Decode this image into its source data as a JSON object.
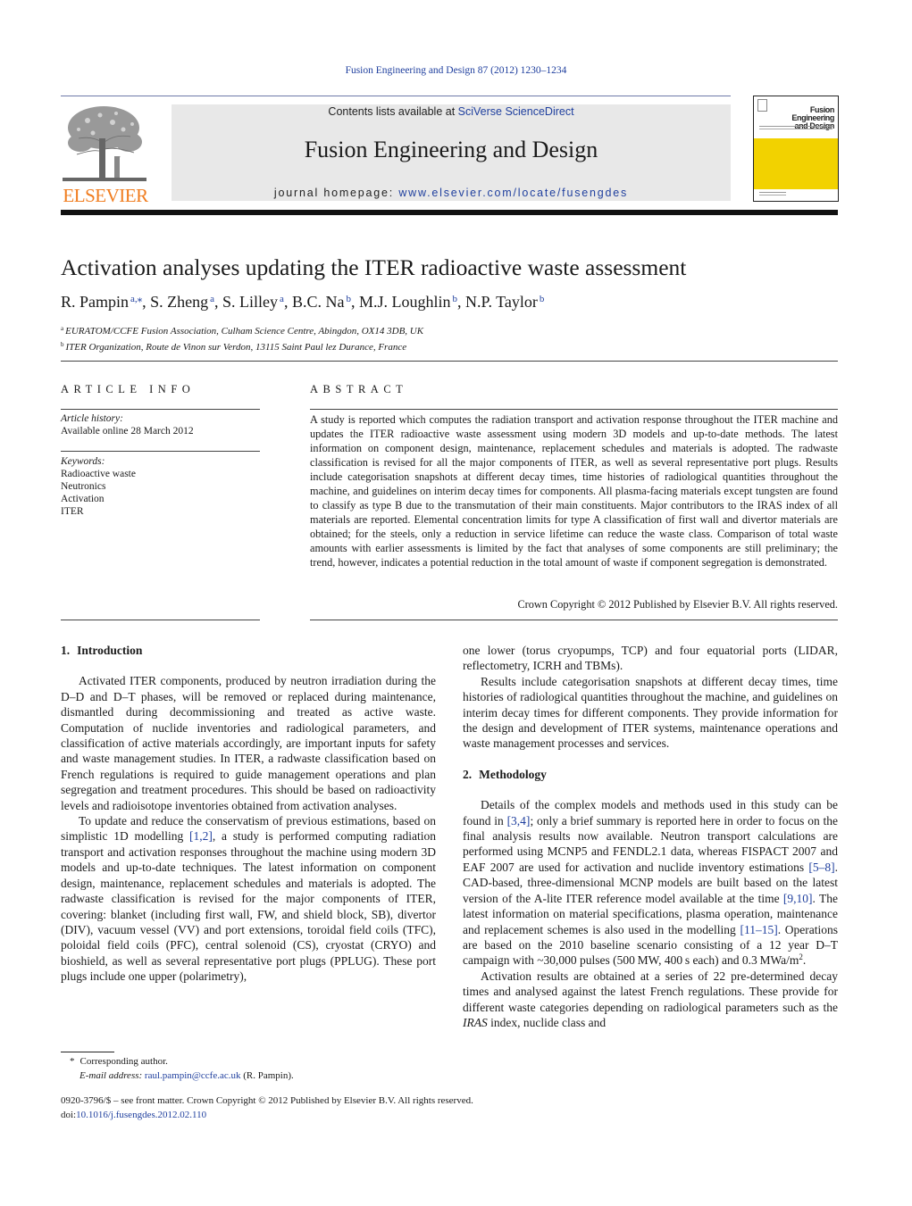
{
  "running_header": "Fusion Engineering and Design 87 (2012) 1230–1234",
  "masthead": {
    "publisher_logo_text": "ELSEVIER",
    "contents_prefix": "Contents lists available at ",
    "contents_link": "SciVerse ScienceDirect",
    "journal_title": "Fusion Engineering and Design",
    "homepage_prefix": "journal homepage: ",
    "homepage_link": "www.elsevier.com/locate/fusengdes",
    "cover_title_line1": "Fusion Engineering",
    "cover_title_line2": "and Design",
    "colors": {
      "logo_orange": "#f07c1e",
      "cover_yellow": "#f2d200",
      "link_blue": "#1f3f9e",
      "masthead_gray": "#e8e8e8"
    }
  },
  "article": {
    "title": "Activation analyses updating the ITER radioactive waste assessment",
    "authors": [
      {
        "name": "R. Pampin",
        "aff": "a,⁎"
      },
      {
        "name": "S. Zheng",
        "aff": "a"
      },
      {
        "name": "S. Lilley",
        "aff": "a"
      },
      {
        "name": "B.C. Na",
        "aff": "b"
      },
      {
        "name": "M.J. Loughlin",
        "aff": "b"
      },
      {
        "name": "N.P. Taylor",
        "aff": "b"
      }
    ],
    "affiliations": [
      {
        "mark": "a",
        "text": "EURATOM/CCFE Fusion Association, Culham Science Centre, Abingdon, OX14 3DB, UK"
      },
      {
        "mark": "b",
        "text": "ITER Organization, Route de Vinon sur Verdon, 13115 Saint Paul lez Durance, France"
      }
    ]
  },
  "article_info": {
    "heading": "ARTICLE INFO",
    "history_label": "Article history:",
    "history_value": "Available online 28 March 2012",
    "keywords_label": "Keywords:",
    "keywords": [
      "Radioactive waste",
      "Neutronics",
      "Activation",
      "ITER"
    ]
  },
  "abstract": {
    "heading": "ABSTRACT",
    "text": "A study is reported which computes the radiation transport and activation response throughout the ITER machine and updates the ITER radioactive waste assessment using modern 3D models and up-to-date methods. The latest information on component design, maintenance, replacement schedules and materials is adopted. The radwaste classification is revised for all the major components of ITER, as well as several representative port plugs. Results include categorisation snapshots at different decay times, time histories of radiological quantities throughout the machine, and guidelines on interim decay times for components. All plasma-facing materials except tungsten are found to classify as type B due to the transmutation of their main constituents. Major contributors to the IRAS index of all materials are reported. Elemental concentration limits for type A classification of first wall and divertor materials are obtained; for the steels, only a reduction in service lifetime can reduce the waste class. Comparison of total waste amounts with earlier assessments is limited by the fact that analyses of some components are still preliminary; the trend, however, indicates a potential reduction in the total amount of waste if component segregation is demonstrated.",
    "copyright": "Crown Copyright © 2012 Published by Elsevier B.V. All rights reserved."
  },
  "sections": {
    "intro": {
      "number": "1.",
      "title": "Introduction",
      "p1": "Activated ITER components, produced by neutron irradiation during the D–D and D–T phases, will be removed or replaced during maintenance, dismantled during decommissioning and treated as active waste. Computation of nuclide inventories and radiological parameters, and classification of active materials accordingly, are important inputs for safety and waste management studies. In ITER, a radwaste classification based on French regulations is required to guide management operations and plan segregation and treatment procedures. This should be based on radioactivity levels and radioisotope inventories obtained from activation analyses.",
      "p2_a": "To update and reduce the conservatism of previous estimations, based on simplistic 1D modelling ",
      "p2_ref": "[1,2]",
      "p2_b": ", a study is performed computing radiation transport and activation responses throughout the machine using modern 3D models and up-to-date techniques. The latest information on component design, maintenance, replacement schedules and materials is adopted. The radwaste classification is revised for the major components of ITER, covering: blanket (including first wall, FW, and shield block, SB), divertor (DIV), vacuum vessel (VV) and port extensions, toroidal field coils (TFC), poloidal field coils (PFC), central solenoid (CS), cryostat (CRYO) and bioshield, as well as several representative port plugs (PPLUG). These port plugs include one upper (polarimetry),",
      "p2_cont": "one lower (torus cryopumps, TCP) and four equatorial ports (LIDAR, reflectometry, ICRH and TBMs).",
      "p3": "Results include categorisation snapshots at different decay times, time histories of radiological quantities throughout the machine, and guidelines on interim decay times for different components. They provide information for the design and development of ITER systems, maintenance operations and waste management processes and services."
    },
    "methodology": {
      "number": "2.",
      "title": "Methodology",
      "p1_a": "Details of the complex models and methods used in this study can be found in ",
      "p1_ref1": "[3,4]",
      "p1_b": "; only a brief summary is reported here in order to focus on the final analysis results now available. Neutron transport calculations are performed using MCNP5 and FENDL2.1 data, whereas FISPACT 2007 and EAF 2007 are used for activation and nuclide inventory estimations ",
      "p1_ref2": "[5–8]",
      "p1_c": ". CAD-based, three-dimensional MCNP models are built based on the latest version of the A-lite ITER reference model available at the time ",
      "p1_ref3": "[9,10]",
      "p1_d": ". The latest information on material specifications, plasma operation, maintenance and replacement schemes is also used in the modelling ",
      "p1_ref4": "[11–15]",
      "p1_e": ". Operations are based on the 2010 baseline scenario consisting of a 12 year D–T campaign with ~30,000 pulses (500 MW, 400 s each) and 0.3 MWa/m",
      "p1_sup": "2",
      "p1_f": ".",
      "p2_a": "Activation results are obtained at a series of 22 pre-determined decay times and analysed against the latest French regulations. These provide for different waste categories depending on radiological parameters such as the ",
      "p2_italic": "IRAS",
      "p2_b": " index, nuclide class and"
    }
  },
  "footnote": {
    "star": "*",
    "corresponding": "Corresponding author.",
    "email_label": "E-mail address:",
    "email": "raul.pampin@ccfe.ac.uk",
    "email_suffix": " (R. Pampin)."
  },
  "front_matter": {
    "issn_line": "0920-3796/$ – see front matter. Crown Copyright © 2012 Published by Elsevier B.V. All rights reserved.",
    "doi_prefix": "doi:",
    "doi": "10.1016/j.fusengdes.2012.02.110"
  }
}
